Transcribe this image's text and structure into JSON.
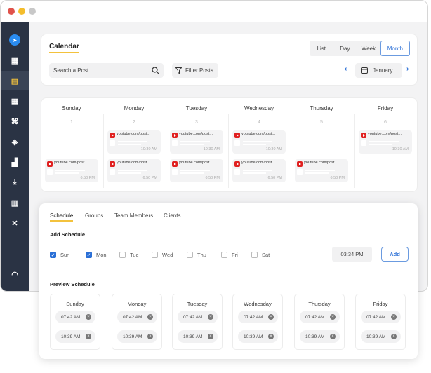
{
  "header": {
    "title": "Calendar",
    "search_placeholder": "Search a Post",
    "filter_label": "Filter Posts",
    "views": [
      "List",
      "Day",
      "Week",
      "Month"
    ],
    "active_view": "Month",
    "month": "January"
  },
  "sidebar": {
    "items": [
      "send-logo",
      "dashboard",
      "posts",
      "calendar",
      "network",
      "target",
      "analytics",
      "inbox",
      "library",
      "tools",
      "support"
    ],
    "active": "posts"
  },
  "calendar": {
    "days": [
      {
        "name": "Sunday",
        "num": "1",
        "posts": [
          {
            "url": "youtube.com/post...",
            "time": "6:50 PM",
            "slot": "bottom"
          }
        ]
      },
      {
        "name": "Monday",
        "num": "2",
        "posts": [
          {
            "url": "youtube.com/post...",
            "time": "10:30 AM",
            "slot": "top"
          },
          {
            "url": "youtube.com/post...",
            "time": "6:50 PM",
            "slot": "bottom"
          }
        ]
      },
      {
        "name": "Tuesday",
        "num": "3",
        "posts": [
          {
            "url": "youtube.com/post...",
            "time": "10:30 AM",
            "slot": "top"
          },
          {
            "url": "youtube.com/post...",
            "time": "6:50 PM",
            "slot": "bottom"
          }
        ]
      },
      {
        "name": "Wednesday",
        "num": "4",
        "posts": [
          {
            "url": "youtube.com/post...",
            "time": "10:30 AM",
            "slot": "top"
          },
          {
            "url": "youtube.com/post...",
            "time": "6:50 PM",
            "slot": "bottom"
          }
        ]
      },
      {
        "name": "Thursday",
        "num": "5",
        "posts": [
          {
            "url": "youtube.com/post...",
            "time": "6:50 PM",
            "slot": "bottom"
          }
        ]
      },
      {
        "name": "Friday",
        "num": "6",
        "posts": [
          {
            "url": "youtube.com/post...",
            "time": "10:30 AM",
            "slot": "top"
          }
        ]
      }
    ]
  },
  "schedule": {
    "tabs": [
      "Schedule",
      "Groups",
      "Team Members",
      "Clients"
    ],
    "active_tab": "Schedule",
    "add_title": "Add Schedule",
    "weekdays": [
      {
        "label": "Sun",
        "checked": true
      },
      {
        "label": "Mon",
        "checked": true
      },
      {
        "label": "Tue",
        "checked": false
      },
      {
        "label": "Wed",
        "checked": false
      },
      {
        "label": "Thu",
        "checked": false
      },
      {
        "label": "Fri",
        "checked": false
      },
      {
        "label": "Sat",
        "checked": false
      }
    ],
    "time": "03:34 PM",
    "add_label": "Add",
    "preview_title": "Preview Schedule",
    "preview": [
      {
        "day": "Sunday",
        "times": [
          "07:42 AM",
          "10:39 AM"
        ]
      },
      {
        "day": "Monday",
        "times": [
          "07:42 AM",
          "10:39 AM"
        ]
      },
      {
        "day": "Tuesday",
        "times": [
          "07:42 AM",
          "10:39 AM"
        ]
      },
      {
        "day": "Wednesday",
        "times": [
          "07:42 AM",
          "10:39 AM"
        ]
      },
      {
        "day": "Thursday",
        "times": [
          "07:42 AM",
          "10:39 AM"
        ]
      },
      {
        "day": "Friday",
        "times": [
          "07:42 AM",
          "10:39 AM"
        ]
      }
    ]
  },
  "colors": {
    "sidebar": "#2a3344",
    "accent": "#2a6fd6",
    "underline": "#f3c23d",
    "youtube": "#e02020"
  }
}
